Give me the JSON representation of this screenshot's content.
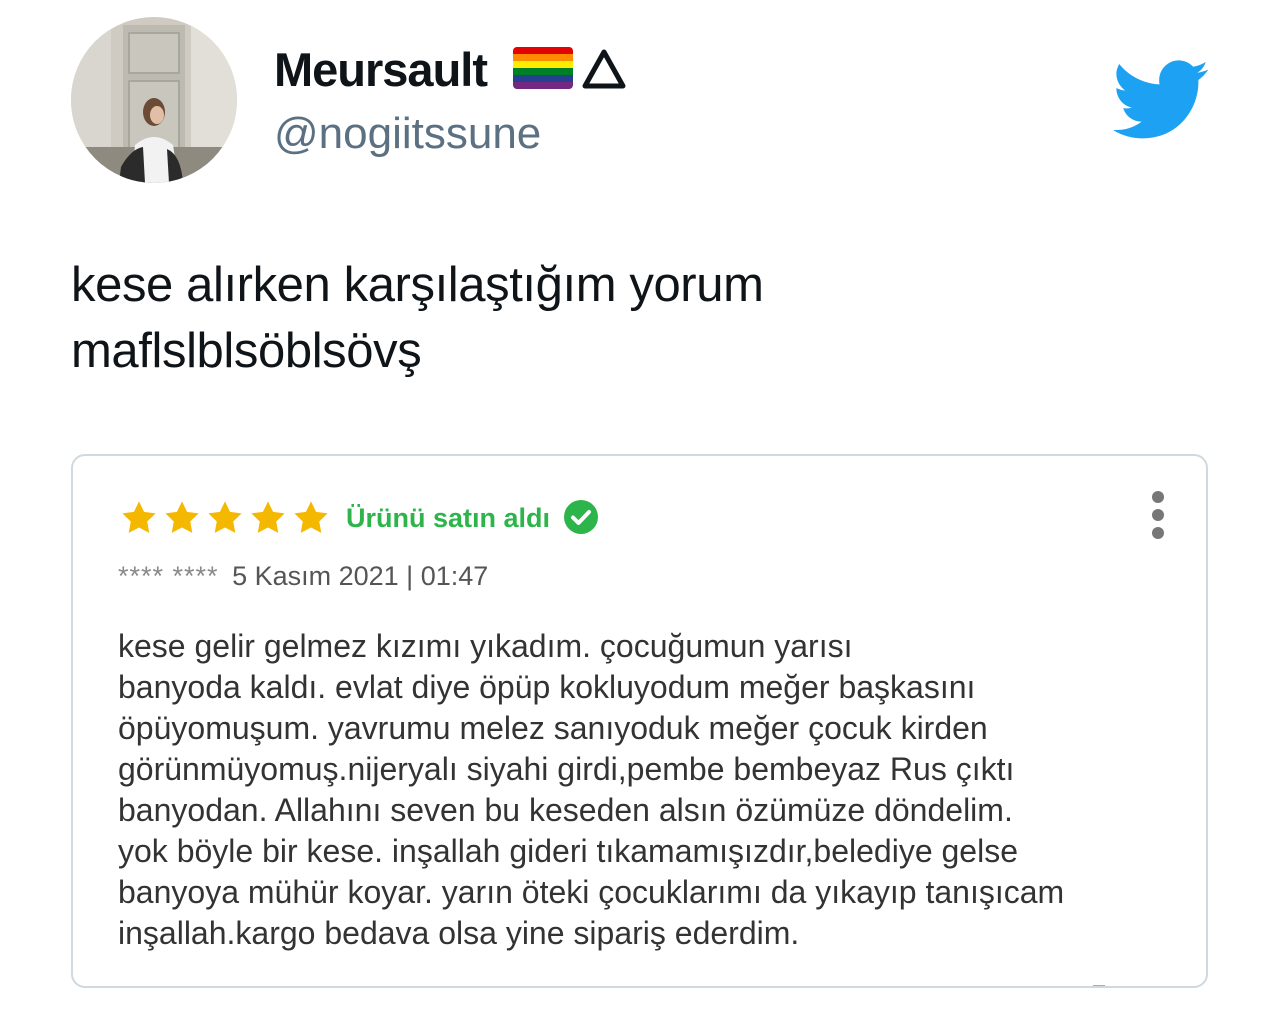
{
  "user": {
    "display_name": "Meursault",
    "handle": "@nogiitssune",
    "flag_icon": "rainbow-flag-icon",
    "symbol_icon": "triangle-icon"
  },
  "tweet": {
    "lines": [
      "kese alırken karşılaştığım yorum",
      "maflslblsöblsövş"
    ]
  },
  "review": {
    "rating": 5,
    "purchased_label": "Ürünü satın aldı",
    "author": "**** ****",
    "date": "5 Kasım 2021 | 01:47",
    "lines": [
      "kese gelir gelmez kızımı yıkadım. çocuğumun yarısı",
      "banyoda kaldı. evlat diye öpüp kokluyodum meğer başkasını",
      "öpüyomuşum. yavrumu melez sanıyoduk meğer çocuk kirden",
      "görünmüyomuş.nijeryalı siyahi girdi,pembe bembeyaz Rus çıktı",
      "banyodan. Allahını seven bu keseden alsın özümüze döndelim.",
      "yok böyle bir kese. inşallah gideri tıkamamışızdır,belediye gelse",
      "banyoya mühür koyar. yarın öteki çocuklarımı da yıkayıp tanışıcam",
      "inşallah.kargo bedava olsa yine sipariş ederdim."
    ]
  },
  "colors": {
    "twitter_blue": "#1da1f2",
    "star_yellow": "#f5b800",
    "verified_green": "#2db44a",
    "handle_gray": "#5b7083"
  }
}
